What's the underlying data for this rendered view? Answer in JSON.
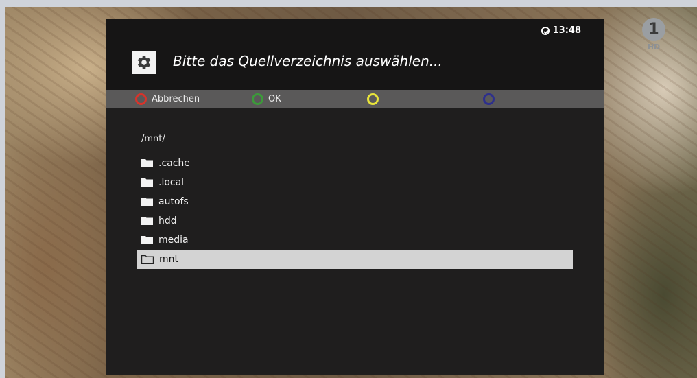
{
  "channel": {
    "logo_text": "1",
    "badge": "HD"
  },
  "dialog": {
    "title": "Bitte das Quellverzeichnis auswählen...",
    "clock": "13:48"
  },
  "buttons": {
    "red": "Abbrechen",
    "green": "OK",
    "yellow": "",
    "blue": ""
  },
  "colors": {
    "red": "#d8332a",
    "green": "#3c9a3a",
    "yellow": "#e9e53b",
    "blue": "#2d2f8c"
  },
  "browser": {
    "current_path": "/mnt/",
    "items": [
      {
        "name": ".cache",
        "icon": "folder-icon"
      },
      {
        "name": ".local",
        "icon": "folder-icon"
      },
      {
        "name": "autofs",
        "icon": "folder-icon"
      },
      {
        "name": "hdd",
        "icon": "folder-icon"
      },
      {
        "name": "media",
        "icon": "folder-icon"
      },
      {
        "name": "mnt",
        "icon": "folder-outline-icon",
        "selected": true
      }
    ]
  }
}
